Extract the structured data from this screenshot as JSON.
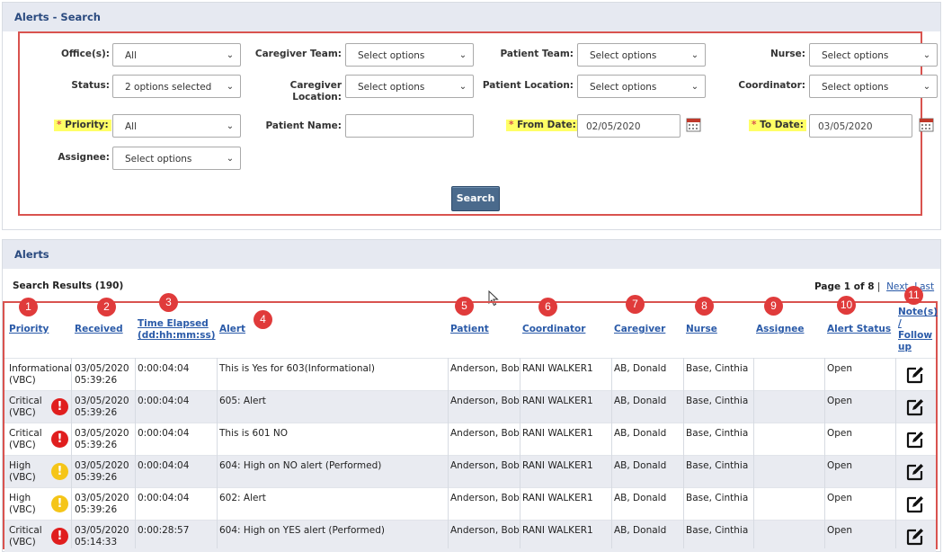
{
  "search_panel": {
    "title": "Alerts - Search"
  },
  "filters": {
    "offices": {
      "label": "Office(s):",
      "value": "All"
    },
    "caregiver_team": {
      "label": "Caregiver Team:",
      "value": "Select options"
    },
    "patient_team": {
      "label": "Patient Team:",
      "value": "Select options"
    },
    "nurse": {
      "label": "Nurse:",
      "value": "Select options"
    },
    "status": {
      "label": "Status:",
      "value": "2 options selected"
    },
    "caregiver_location": {
      "label_line1": "Caregiver",
      "label_line2": "Location:",
      "value": "Select options"
    },
    "patient_location": {
      "label": "Patient Location:",
      "value": "Select options"
    },
    "coordinator": {
      "label": "Coordinator:",
      "value": "Select options"
    },
    "priority": {
      "star": "*",
      "label": "Priority:",
      "value": "All"
    },
    "patient_name": {
      "label": "Patient Name:",
      "value": ""
    },
    "from_date": {
      "star": "*",
      "label": "From Date:",
      "value": "02/05/2020"
    },
    "to_date": {
      "star": "*",
      "label": "To Date:",
      "value": "03/05/2020"
    },
    "assignee": {
      "label": "Assignee:",
      "value": "Select options"
    },
    "search_button": "Search"
  },
  "alerts_panel": {
    "title": "Alerts"
  },
  "results": {
    "title": "Search Results (190)",
    "pager": {
      "page_text": "Page 1 of 8",
      "sep": "|",
      "next": "Next",
      "last": "Last"
    }
  },
  "columns": {
    "priority": "Priority",
    "received": "Received",
    "time_elapsed_1": "Time Elapsed",
    "time_elapsed_2": "(dd:hh:mm:ss)",
    "alert": "Alert",
    "patient": "Patient",
    "coordinator": "Coordinator",
    "caregiver": "Caregiver",
    "nurse": "Nurse",
    "assignee": "Assignee",
    "alert_status": "Alert Status",
    "notes_1": "Note(s)",
    "notes_2": "/",
    "notes_3": "Follow",
    "notes_4": "up"
  },
  "badges": [
    "1",
    "2",
    "3",
    "4",
    "5",
    "6",
    "7",
    "8",
    "9",
    "10",
    "11"
  ],
  "rows": [
    {
      "priority_1": "Informational",
      "priority_2": "(VBC)",
      "level": "none",
      "received_1": "03/05/2020",
      "received_2": "05:39:26",
      "elapsed": "0:00:04:04",
      "alert": "This is Yes for 603(Informational)",
      "patient": "Anderson, Bob",
      "coordinator": "RANI WALKER1",
      "caregiver": "AB, Donald",
      "nurse": "Base, Cinthia",
      "assignee": "",
      "status": "Open"
    },
    {
      "priority_1": "Critical",
      "priority_2": "(VBC)",
      "level": "critical",
      "received_1": "03/05/2020",
      "received_2": "05:39:26",
      "elapsed": "0:00:04:04",
      "alert": "605: Alert",
      "patient": "Anderson, Bob",
      "coordinator": "RANI WALKER1",
      "caregiver": "AB, Donald",
      "nurse": "Base, Cinthia",
      "assignee": "",
      "status": "Open"
    },
    {
      "priority_1": "Critical",
      "priority_2": "(VBC)",
      "level": "critical",
      "received_1": "03/05/2020",
      "received_2": "05:39:26",
      "elapsed": "0:00:04:04",
      "alert": "This is 601 NO",
      "patient": "Anderson, Bob",
      "coordinator": "RANI WALKER1",
      "caregiver": "AB, Donald",
      "nurse": "Base, Cinthia",
      "assignee": "",
      "status": "Open"
    },
    {
      "priority_1": "High",
      "priority_2": "(VBC)",
      "level": "high",
      "received_1": "03/05/2020",
      "received_2": "05:39:26",
      "elapsed": "0:00:04:04",
      "alert": "604: High on NO alert (Performed)",
      "patient": "Anderson, Bob",
      "coordinator": "RANI WALKER1",
      "caregiver": "AB, Donald",
      "nurse": "Base, Cinthia",
      "assignee": "",
      "status": "Open"
    },
    {
      "priority_1": "High",
      "priority_2": "(VBC)",
      "level": "high",
      "received_1": "03/05/2020",
      "received_2": "05:39:26",
      "elapsed": "0:00:04:04",
      "alert": "602: Alert",
      "patient": "Anderson, Bob",
      "coordinator": "RANI WALKER1",
      "caregiver": "AB, Donald",
      "nurse": "Base, Cinthia",
      "assignee": "",
      "status": "Open"
    },
    {
      "priority_1": "Critical",
      "priority_2": "(VBC)",
      "level": "critical",
      "received_1": "03/05/2020",
      "received_2": "05:14:33",
      "elapsed": "0:00:28:57",
      "alert": "604: High on YES alert (Performed)",
      "patient": "Anderson, Bob",
      "coordinator": "RANI WALKER1",
      "caregiver": "AB, Donald",
      "nurse": "Base, Cinthia",
      "assignee": "",
      "status": "Open"
    }
  ],
  "icons": {
    "critical": "exclamation-red-icon",
    "high": "exclamation-yellow-icon",
    "note": "edit-note-icon",
    "calendar": "calendar-icon"
  }
}
